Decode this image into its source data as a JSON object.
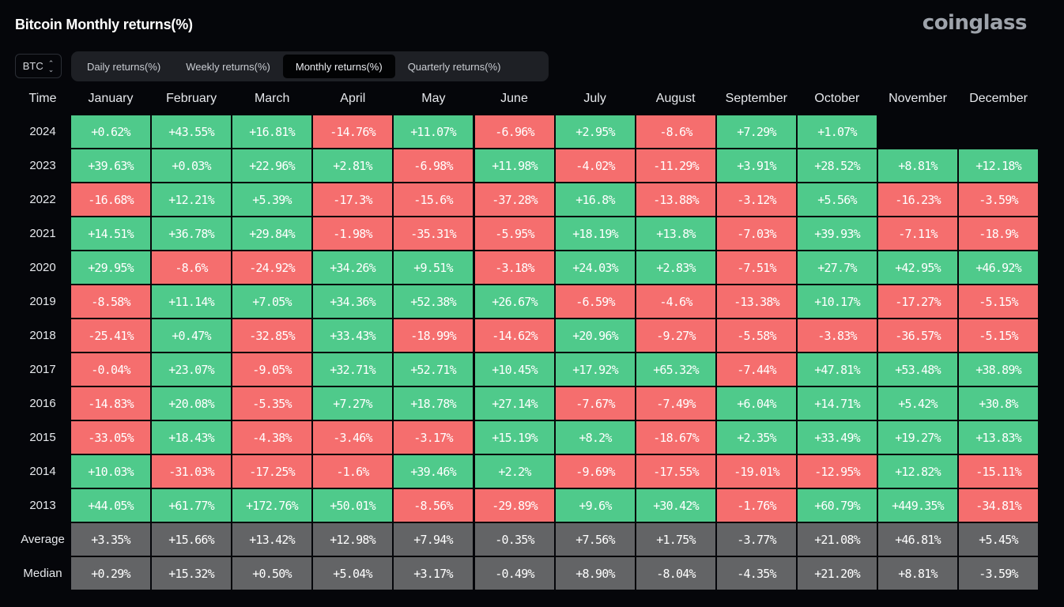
{
  "header": {
    "title": "Bitcoin Monthly returns(%)",
    "logo": "coinglass"
  },
  "controls": {
    "asset": "BTC",
    "asset_icon": "chevron-up-down-icon",
    "tabs": [
      {
        "label": "Daily returns(%)",
        "active": false
      },
      {
        "label": "Weekly returns(%)",
        "active": false
      },
      {
        "label": "Monthly returns(%)",
        "active": true
      },
      {
        "label": "Quarterly returns(%)",
        "active": false
      }
    ]
  },
  "colors": {
    "positive": "#4fca8b",
    "negative": "#f56e6e",
    "stat": "#636466",
    "background": "#05060a"
  },
  "chart_data": {
    "type": "heatmap",
    "title": "Bitcoin Monthly returns(%)",
    "row_header": "Time",
    "columns": [
      "January",
      "February",
      "March",
      "April",
      "May",
      "June",
      "July",
      "August",
      "September",
      "October",
      "November",
      "December"
    ],
    "rows": [
      {
        "label": "2024",
        "values": [
          "+0.62%",
          "+43.55%",
          "+16.81%",
          "-14.76%",
          "+11.07%",
          "-6.96%",
          "+2.95%",
          "-8.6%",
          "+7.29%",
          "+1.07%",
          null,
          null
        ]
      },
      {
        "label": "2023",
        "values": [
          "+39.63%",
          "+0.03%",
          "+22.96%",
          "+2.81%",
          "-6.98%",
          "+11.98%",
          "-4.02%",
          "-11.29%",
          "+3.91%",
          "+28.52%",
          "+8.81%",
          "+12.18%"
        ]
      },
      {
        "label": "2022",
        "values": [
          "-16.68%",
          "+12.21%",
          "+5.39%",
          "-17.3%",
          "-15.6%",
          "-37.28%",
          "+16.8%",
          "-13.88%",
          "-3.12%",
          "+5.56%",
          "-16.23%",
          "-3.59%"
        ]
      },
      {
        "label": "2021",
        "values": [
          "+14.51%",
          "+36.78%",
          "+29.84%",
          "-1.98%",
          "-35.31%",
          "-5.95%",
          "+18.19%",
          "+13.8%",
          "-7.03%",
          "+39.93%",
          "-7.11%",
          "-18.9%"
        ]
      },
      {
        "label": "2020",
        "values": [
          "+29.95%",
          "-8.6%",
          "-24.92%",
          "+34.26%",
          "+9.51%",
          "-3.18%",
          "+24.03%",
          "+2.83%",
          "-7.51%",
          "+27.7%",
          "+42.95%",
          "+46.92%"
        ]
      },
      {
        "label": "2019",
        "values": [
          "-8.58%",
          "+11.14%",
          "+7.05%",
          "+34.36%",
          "+52.38%",
          "+26.67%",
          "-6.59%",
          "-4.6%",
          "-13.38%",
          "+10.17%",
          "-17.27%",
          "-5.15%"
        ]
      },
      {
        "label": "2018",
        "values": [
          "-25.41%",
          "+0.47%",
          "-32.85%",
          "+33.43%",
          "-18.99%",
          "-14.62%",
          "+20.96%",
          "-9.27%",
          "-5.58%",
          "-3.83%",
          "-36.57%",
          "-5.15%"
        ]
      },
      {
        "label": "2017",
        "values": [
          "-0.04%",
          "+23.07%",
          "-9.05%",
          "+32.71%",
          "+52.71%",
          "+10.45%",
          "+17.92%",
          "+65.32%",
          "-7.44%",
          "+47.81%",
          "+53.48%",
          "+38.89%"
        ]
      },
      {
        "label": "2016",
        "values": [
          "-14.83%",
          "+20.08%",
          "-5.35%",
          "+7.27%",
          "+18.78%",
          "+27.14%",
          "-7.67%",
          "-7.49%",
          "+6.04%",
          "+14.71%",
          "+5.42%",
          "+30.8%"
        ]
      },
      {
        "label": "2015",
        "values": [
          "-33.05%",
          "+18.43%",
          "-4.38%",
          "-3.46%",
          "-3.17%",
          "+15.19%",
          "+8.2%",
          "-18.67%",
          "+2.35%",
          "+33.49%",
          "+19.27%",
          "+13.83%"
        ]
      },
      {
        "label": "2014",
        "values": [
          "+10.03%",
          "-31.03%",
          "-17.25%",
          "-1.6%",
          "+39.46%",
          "+2.2%",
          "-9.69%",
          "-17.55%",
          "-19.01%",
          "-12.95%",
          "+12.82%",
          "-15.11%"
        ]
      },
      {
        "label": "2013",
        "values": [
          "+44.05%",
          "+61.77%",
          "+172.76%",
          "+50.01%",
          "-8.56%",
          "-29.89%",
          "+9.6%",
          "+30.42%",
          "-1.76%",
          "+60.79%",
          "+449.35%",
          "-34.81%"
        ]
      }
    ],
    "summary_rows": [
      {
        "label": "Average",
        "values": [
          "+3.35%",
          "+15.66%",
          "+13.42%",
          "+12.98%",
          "+7.94%",
          "-0.35%",
          "+7.56%",
          "+1.75%",
          "-3.77%",
          "+21.08%",
          "+46.81%",
          "+5.45%"
        ]
      },
      {
        "label": "Median",
        "values": [
          "+0.29%",
          "+15.32%",
          "+0.50%",
          "+5.04%",
          "+3.17%",
          "-0.49%",
          "+8.90%",
          "-8.04%",
          "-4.35%",
          "+21.20%",
          "+8.81%",
          "-3.59%"
        ]
      }
    ]
  }
}
